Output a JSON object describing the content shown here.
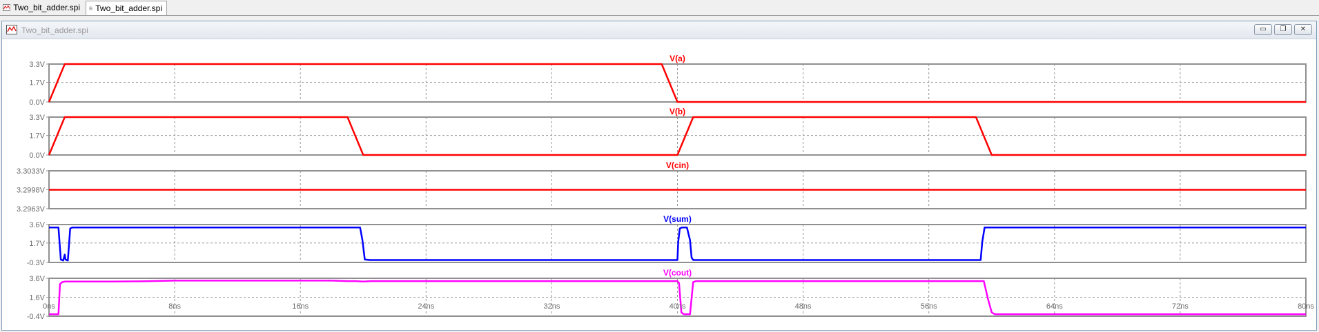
{
  "tabs": [
    {
      "label": "Two_bit_adder.spi",
      "icon": "waveform-icon",
      "active": false
    },
    {
      "label": "Two_bit_adder.spi",
      "icon": "netlist-document-icon",
      "active": true
    }
  ],
  "window": {
    "title": "Two_bit_adder.spi",
    "min_symbol": "▭",
    "restore_symbol": "❐",
    "close_symbol": "✕"
  },
  "colors": {
    "red": "#ff0000",
    "blue": "#0000ff",
    "magenta": "#ff00ff",
    "grid": "#969696",
    "frame": "#909090",
    "axis_text": "#6a6a6a"
  },
  "chart_data": {
    "type": "line",
    "xlabel": "",
    "xlim": [
      0,
      80
    ],
    "x_ticks": [
      "0ns",
      "8ns",
      "16ns",
      "24ns",
      "32ns",
      "40ns",
      "48ns",
      "56ns",
      "64ns",
      "72ns",
      "80ns"
    ],
    "x_tick_values": [
      0,
      8,
      16,
      24,
      32,
      40,
      48,
      56,
      64,
      72,
      80
    ],
    "grid": true,
    "panes": [
      {
        "name": "V(a)",
        "color": "#ff0000",
        "ylim": [
          0,
          3.3
        ],
        "y_ticks": [
          "3.3V",
          "1.7V",
          "0.0V"
        ],
        "y_tick_values": [
          3.3,
          1.7,
          0.0
        ],
        "x": [
          0,
          1,
          39.0,
          40.0,
          80
        ],
        "y": [
          0,
          3.3,
          3.3,
          0,
          0
        ]
      },
      {
        "name": "V(b)",
        "color": "#ff0000",
        "ylim": [
          0,
          3.3
        ],
        "y_ticks": [
          "3.3V",
          "1.7V",
          "0.0V"
        ],
        "y_tick_values": [
          3.3,
          1.7,
          0.0
        ],
        "x": [
          0,
          1,
          19.0,
          20.0,
          40.0,
          41.0,
          59.0,
          60.0,
          80
        ],
        "y": [
          0,
          3.3,
          3.3,
          0,
          0,
          3.3,
          3.3,
          0,
          0
        ]
      },
      {
        "name": "V(cin)",
        "color": "#ff0000",
        "ylim": [
          3.2963,
          3.3033
        ],
        "y_ticks": [
          "3.3033V",
          "3.2998V",
          "3.2963V"
        ],
        "y_tick_values": [
          3.3033,
          3.2998,
          3.2963
        ],
        "x": [
          0,
          80
        ],
        "y": [
          3.2998,
          3.2998
        ]
      },
      {
        "name": "V(sum)",
        "color": "#0000ff",
        "ylim": [
          -0.3,
          3.6
        ],
        "y_ticks": [
          "3.6V",
          "1.7V",
          "-0.3V"
        ],
        "y_tick_values": [
          3.6,
          1.7,
          -0.3
        ],
        "x": [
          0,
          0.6,
          0.75,
          0.9,
          1.0,
          1.05,
          1.2,
          1.35,
          1.5,
          19.8,
          19.95,
          20.1,
          20.4,
          40.0,
          40.05,
          40.15,
          40.3,
          40.6,
          40.8,
          40.9,
          41.0,
          41.2,
          59.3,
          59.4,
          59.55,
          80
        ],
        "y": [
          3.3,
          3.3,
          0.0,
          -0.1,
          0.5,
          0.0,
          -0.1,
          3.2,
          3.3,
          3.3,
          2.0,
          0.0,
          -0.05,
          -0.05,
          1.8,
          3.2,
          3.3,
          3.3,
          2.0,
          0.2,
          -0.05,
          -0.05,
          -0.05,
          1.8,
          3.3,
          3.3
        ]
      },
      {
        "name": "V(cout)",
        "color": "#ff00ff",
        "ylim": [
          -0.4,
          3.6
        ],
        "y_ticks": [
          "3.6V",
          "1.6V",
          "-0.4V"
        ],
        "y_tick_values": [
          3.6,
          1.6,
          -0.4
        ],
        "x": [
          0,
          0.6,
          0.7,
          0.85,
          1.0,
          4.0,
          6.0,
          8.0,
          18.0,
          19.0,
          19.5,
          20.0,
          20.5,
          40.0,
          40.1,
          40.25,
          40.4,
          40.8,
          40.9,
          41.0,
          41.2,
          59.0,
          59.5,
          59.75,
          60.0,
          60.2,
          80
        ],
        "y": [
          -0.2,
          -0.2,
          3.0,
          3.2,
          3.25,
          3.25,
          3.28,
          3.35,
          3.35,
          3.3,
          3.3,
          3.25,
          3.3,
          3.3,
          3.1,
          0.0,
          -0.2,
          -0.2,
          1.5,
          3.2,
          3.3,
          3.3,
          3.3,
          1.5,
          0.0,
          -0.2,
          -0.2
        ]
      }
    ]
  }
}
